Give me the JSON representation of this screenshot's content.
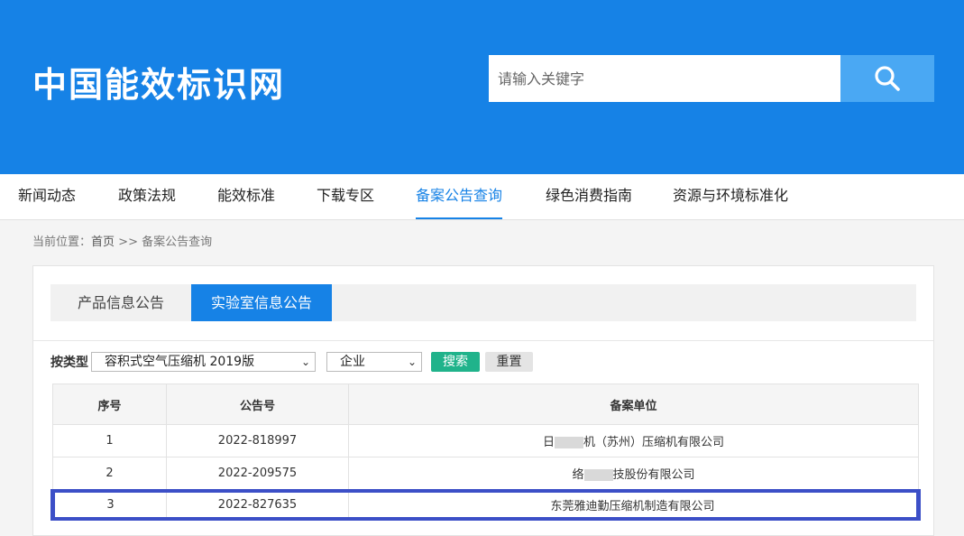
{
  "header": {
    "logo": "中国能效标识网",
    "search_placeholder": "请输入关键字",
    "search_icon": "search-icon"
  },
  "nav": {
    "items": [
      {
        "label": "新闻动态"
      },
      {
        "label": "政策法规"
      },
      {
        "label": "能效标准"
      },
      {
        "label": "下载专区"
      },
      {
        "label": "备案公告查询",
        "active": true
      },
      {
        "label": "绿色消费指南"
      },
      {
        "label": "资源与环境标准化"
      }
    ]
  },
  "breadcrumb": {
    "prefix": "当前位置：",
    "home": "首页",
    "sep": ">>",
    "current": "备案公告查询"
  },
  "tabs": [
    {
      "label": "产品信息公告"
    },
    {
      "label": "实验室信息公告",
      "active": true
    }
  ],
  "filter": {
    "label": "按类型",
    "type_value": "容积式空气压缩机 2019版",
    "kind_value": "企业",
    "search_label": "搜索",
    "reset_label": "重置",
    "chevron_icon": "chevron-down-icon"
  },
  "table": {
    "headers": [
      "序号",
      "公告号",
      "备案单位"
    ],
    "rows": [
      {
        "no": "1",
        "code": "2022-818997",
        "unit_a": "日",
        "unit_b": "机（苏州）压缩机有限公司",
        "redacted": true
      },
      {
        "no": "2",
        "code": "2022-209575",
        "unit_a": "络",
        "unit_b": "技股份有限公司",
        "redacted": true
      },
      {
        "no": "3",
        "code": "2022-827635",
        "unit_a": "东莞雅迪勤压缩机制造有限公司",
        "unit_b": "",
        "redacted": false,
        "highlighted": true
      }
    ]
  },
  "colors": {
    "brand_blue": "#1682e6",
    "search_btn": "#4aa8f3",
    "search_green": "#20b38b",
    "highlight_border": "#3c4fc7"
  }
}
